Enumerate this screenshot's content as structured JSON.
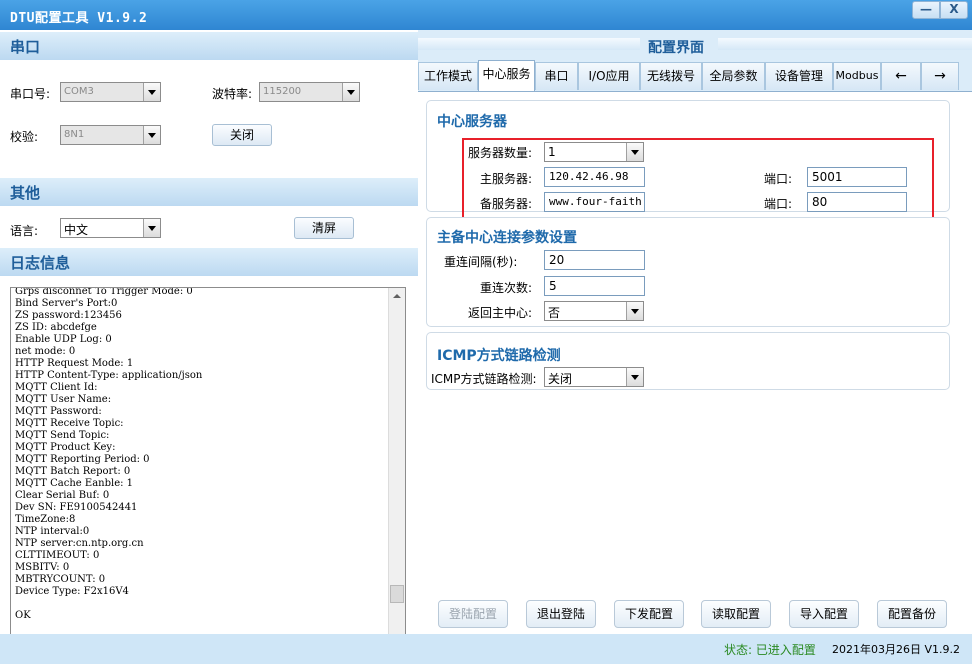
{
  "window": {
    "title": "DTU配置工具 V1.9.2",
    "minimize": "—",
    "close": "X"
  },
  "serial": {
    "header": "串口",
    "port_label": "串口号:",
    "port_value": "COM3",
    "baud_label": "波特率:",
    "baud_value": "115200",
    "parity_label": "校验:",
    "parity_value": "8N1",
    "close_button": "关闭"
  },
  "other": {
    "header": "其他",
    "language_label": "语言:",
    "language_value": "中文",
    "clear_button": "清屏"
  },
  "log": {
    "header": "日志信息",
    "lines": [
      "Grps disconnet To Trigger Mode: 0",
      "Bind Server's Port:0",
      "ZS password:123456",
      "ZS ID: abcdefge",
      "Enable UDP Log: 0",
      "net mode: 0",
      "HTTP Request Mode: 1",
      "HTTP Content-Type: application/json",
      "MQTT Client Id:",
      "MQTT User Name:",
      "MQTT Password:",
      "MQTT Receive Topic:",
      "MQTT Send Topic:",
      "MQTT Product Key:",
      "MQTT Reporting Period: 0",
      "MQTT Batch Report: 0",
      "MQTT Cache Eanble: 1",
      "Clear Serial Buf: 0",
      "Dev SN: FE9100542441",
      "TimeZone:8",
      "NTP interval:0",
      "NTP server:cn.ntp.org.cn",
      "CLTTIMEOUT: 0",
      "MSBITV: 0",
      "MBTRYCOUNT: 0",
      "Device Type: F2x16V4"
    ],
    "last_line": "OK"
  },
  "config": {
    "title": "配置界面",
    "tabs": [
      "工作模式",
      "中心服务",
      "串口",
      "I/O应用",
      "无线拨号",
      "全局参数",
      "设备管理",
      "Modbus"
    ],
    "active_tab": 1,
    "tab_prev": "←",
    "tab_next": "→",
    "center_service": {
      "title": "中心服务器",
      "count_label": "服务器数量:",
      "count_value": "1",
      "main_label": "主服务器:",
      "main_value": "120.42.46.98",
      "main_port_label": "端口:",
      "main_port_value": "5001",
      "backup_label": "备服务器:",
      "backup_value": "www.four-faith.c",
      "backup_port_label": "端口:",
      "backup_port_value": "80"
    },
    "reconnect": {
      "title": "主备中心连接参数设置",
      "interval_label": "重连间隔(秒):",
      "interval_value": "20",
      "count_label": "重连次数:",
      "count_value": "5",
      "return_label": "返回主中心:",
      "return_value": "否"
    },
    "icmp": {
      "title": "ICMP方式链路检测",
      "label": "ICMP方式链路检测:",
      "value": "关闭"
    },
    "buttons": {
      "login": "登陆配置",
      "logout": "退出登陆",
      "send": "下发配置",
      "read": "读取配置",
      "import": "导入配置",
      "backup": "配置备份"
    }
  },
  "status_bar": {
    "status": "状态: 已进入配置",
    "date_version": "2021年03月26日 V1.9.2"
  },
  "colors": {
    "status_green": "#2a8a22",
    "highlight_red": "#e8202a",
    "header_blue": "#1f5e9a"
  }
}
